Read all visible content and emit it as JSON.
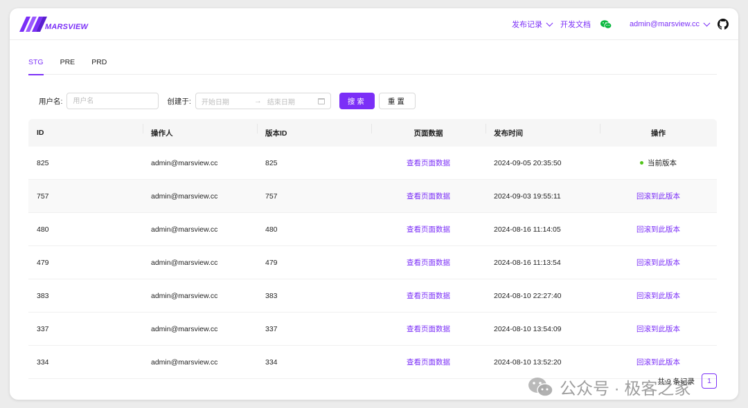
{
  "brand": {
    "logo_text": "MARSVIEW",
    "accent": "#7b2ff7"
  },
  "header": {
    "release_log": "发布记录",
    "dev_docs": "开发文档",
    "user_email": "admin@marsview.cc",
    "icons": [
      "wechat-icon",
      "github-icon"
    ]
  },
  "tabs": [
    {
      "label": "STG",
      "active": true
    },
    {
      "label": "PRE",
      "active": false
    },
    {
      "label": "PRD",
      "active": false
    }
  ],
  "search": {
    "username_label": "用户名:",
    "username_placeholder": "用户名",
    "created_label": "创建于:",
    "start_placeholder": "开始日期",
    "end_placeholder": "结束日期",
    "search_button": "搜索",
    "reset_button": "重置"
  },
  "table": {
    "columns": [
      "ID",
      "操作人",
      "版本ID",
      "页面数据",
      "发布时间",
      "操作"
    ],
    "rows": [
      {
        "id": "825",
        "operator": "admin@marsview.cc",
        "version_id": "825",
        "page_data": "查看页面数据",
        "time": "2024-09-05 20:35:50",
        "action": "当前版本",
        "current": true
      },
      {
        "id": "757",
        "operator": "admin@marsview.cc",
        "version_id": "757",
        "page_data": "查看页面数据",
        "time": "2024-09-03 19:55:11",
        "action": "回滚到此版本",
        "current": false
      },
      {
        "id": "480",
        "operator": "admin@marsview.cc",
        "version_id": "480",
        "page_data": "查看页面数据",
        "time": "2024-08-16 11:14:05",
        "action": "回滚到此版本",
        "current": false
      },
      {
        "id": "479",
        "operator": "admin@marsview.cc",
        "version_id": "479",
        "page_data": "查看页面数据",
        "time": "2024-08-16 11:13:54",
        "action": "回滚到此版本",
        "current": false
      },
      {
        "id": "383",
        "operator": "admin@marsview.cc",
        "version_id": "383",
        "page_data": "查看页面数据",
        "time": "2024-08-10 22:27:40",
        "action": "回滚到此版本",
        "current": false
      },
      {
        "id": "337",
        "operator": "admin@marsview.cc",
        "version_id": "337",
        "page_data": "查看页面数据",
        "time": "2024-08-10 13:54:09",
        "action": "回滚到此版本",
        "current": false
      },
      {
        "id": "334",
        "operator": "admin@marsview.cc",
        "version_id": "334",
        "page_data": "查看页面数据",
        "time": "2024-08-10 13:52:20",
        "action": "回滚到此版本",
        "current": false
      }
    ]
  },
  "pagination": {
    "total_text": "共 9 条记录",
    "current_page": "1"
  },
  "watermark": {
    "text": "公众号 · 极客之家"
  }
}
